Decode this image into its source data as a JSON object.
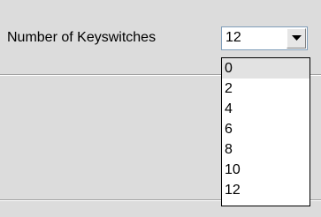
{
  "field": {
    "label": "Number of Keyswitches",
    "selected_value": "12",
    "arrow_icon": "chevron-down-icon"
  },
  "dropdown": {
    "options": [
      "0",
      "2",
      "4",
      "6",
      "8",
      "10",
      "12"
    ],
    "highlighted_option": "0"
  },
  "colors": {
    "panel_background": "#dcdcdc",
    "highlight": "#e2e2e2",
    "combo_border": "#7f9db9"
  }
}
